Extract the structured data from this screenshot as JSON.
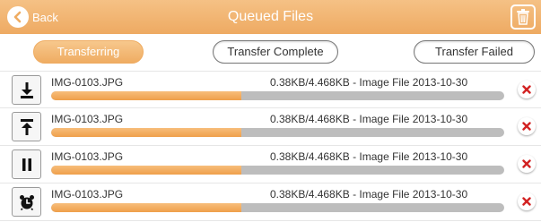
{
  "header": {
    "back_label": "Back",
    "title": "Queued Files",
    "background_color": "#f2b776"
  },
  "tabs": [
    {
      "label": "Transferring",
      "active": true
    },
    {
      "label": "Transfer Complete",
      "active": false
    },
    {
      "label": "Transfer Failed",
      "active": false
    }
  ],
  "items": [
    {
      "icon": "download-icon",
      "filename": "IMG-0103.JPG",
      "info": "0.38KB/4.468KB - Image File 2013-10-30",
      "progress": 0.42
    },
    {
      "icon": "upload-icon",
      "filename": "IMG-0103.JPG",
      "info": "0.38KB/4.468KB - Image File 2013-10-30",
      "progress": 0.42
    },
    {
      "icon": "pause-icon",
      "filename": "IMG-0103.JPG",
      "info": "0.38KB/4.468KB - Image File 2013-10-30",
      "progress": 0.42
    },
    {
      "icon": "alarm-clock-icon",
      "filename": "IMG-0103.JPG",
      "info": "0.38KB/4.468KB - Image File 2013-10-30",
      "progress": 0.42
    }
  ],
  "colors": {
    "accent": "#ef9f4b",
    "progress_track": "#bdbdbd",
    "remove": "#d22222"
  }
}
